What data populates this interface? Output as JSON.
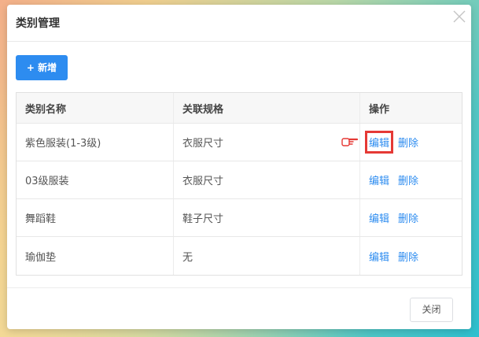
{
  "dialog": {
    "title": "类别管理",
    "add_button_label": "+ 新增",
    "close_button_label": "关闭"
  },
  "table": {
    "headers": [
      "类别名称",
      "关联规格",
      "操作"
    ],
    "rows": [
      {
        "name": "紫色服装(1-3级)",
        "spec": "衣服尺寸",
        "edit": "编辑",
        "delete": "删除"
      },
      {
        "name": "03级服装",
        "spec": "衣服尺寸",
        "edit": "编辑",
        "delete": "删除"
      },
      {
        "name": "舞蹈鞋",
        "spec": "鞋子尺寸",
        "edit": "编辑",
        "delete": "删除"
      },
      {
        "name": "瑜伽垫",
        "spec": "无",
        "edit": "编辑",
        "delete": "删除"
      }
    ]
  },
  "icons": {
    "close": "close-icon",
    "pointer": "pointing-hand-icon"
  },
  "colors": {
    "primary": "#2d8cf0",
    "highlight": "#e53935"
  }
}
